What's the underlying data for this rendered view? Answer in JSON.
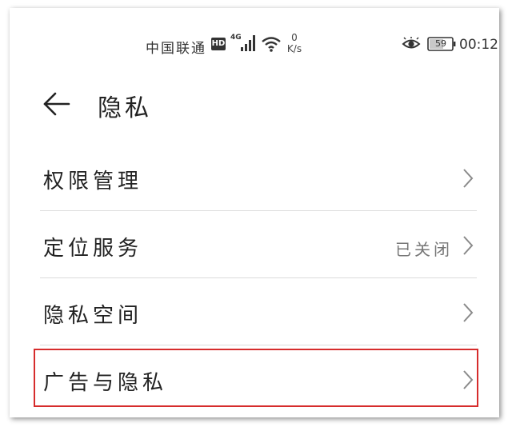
{
  "status_bar": {
    "carrier": "中国联通",
    "hd_badge": "HD",
    "network_type": "4G",
    "net_speed_value": "0",
    "net_speed_unit": "K/s",
    "battery_level": "59",
    "time": "00:12",
    "icons": [
      "hd-icon",
      "signal-icon",
      "wifi-icon",
      "eye-comfort-icon",
      "battery-icon"
    ]
  },
  "header": {
    "title": "隐私",
    "back_icon": "back-arrow-icon"
  },
  "menu": {
    "items": [
      {
        "label": "权限管理",
        "value": ""
      },
      {
        "label": "定位服务",
        "value": "已关闭"
      },
      {
        "label": "隐私空间",
        "value": ""
      },
      {
        "label": "广告与隐私",
        "value": ""
      }
    ],
    "chevron_icon": "chevron-right-icon"
  },
  "colors": {
    "highlight_border": "#d62c2c",
    "divider": "#dcdcdc",
    "text_primary": "#222222",
    "text_secondary": "#777777"
  }
}
